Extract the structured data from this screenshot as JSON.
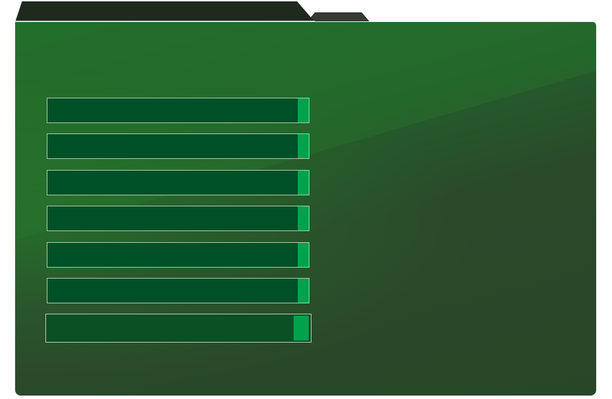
{
  "window": {
    "tabs": [
      {
        "id": "primary",
        "active": true
      },
      {
        "id": "secondary",
        "active": false
      }
    ]
  },
  "colors": {
    "panel": "#22622a",
    "bar": "#005027",
    "bar_fill": "#00a24b",
    "bar_border": "#a9c9a9",
    "tab_dark": "#1f2a1e"
  },
  "bars": [
    {
      "index": 1,
      "selected": false
    },
    {
      "index": 2,
      "selected": false
    },
    {
      "index": 3,
      "selected": false
    },
    {
      "index": 4,
      "selected": false
    },
    {
      "index": 5,
      "selected": false
    },
    {
      "index": 6,
      "selected": false
    },
    {
      "index": 7,
      "selected": true
    }
  ]
}
